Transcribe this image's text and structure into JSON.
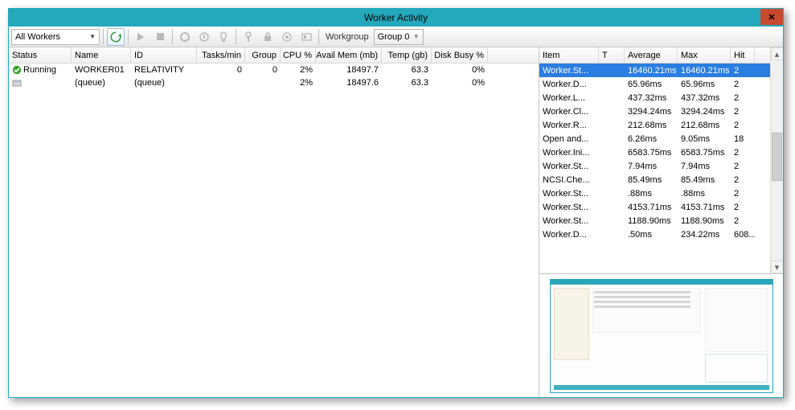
{
  "window": {
    "title": "Worker Activity",
    "close_glyph": "✕"
  },
  "toolbar": {
    "worker_filter": "All Workers",
    "workgroup_label": "Workgroup",
    "group_value": "Group 0"
  },
  "left_grid": {
    "headers": {
      "status": "Status",
      "name": "Name",
      "id": "ID",
      "tasks": "Tasks/min",
      "group": "Group",
      "cpu": "CPU %",
      "mem": "Avail Mem (mb)",
      "temp": "Temp (gb)",
      "disk": "Disk Busy %"
    },
    "rows": [
      {
        "status_icon": "running",
        "status": "Running",
        "name": "WORKER01",
        "id": "RELATIVITY",
        "tasks": "0",
        "group": "0",
        "cpu": "2%",
        "mem": "18497.7",
        "temp": "63.3",
        "disk": "0%"
      },
      {
        "status_icon": "queue",
        "status": "",
        "name": "(queue)",
        "id": "(queue)",
        "tasks": "",
        "group": "",
        "cpu": "2%",
        "mem": "18497.6",
        "temp": "63.3",
        "disk": "0%"
      }
    ]
  },
  "right_grid": {
    "headers": {
      "item": "Item",
      "t": "T",
      "avg": "Average",
      "max": "Max",
      "hit": "Hit"
    },
    "rows": [
      {
        "item": "Worker.St...",
        "t": "",
        "avg": "16460.21ms",
        "max": "16460.21ms",
        "hit": "2",
        "sel": true
      },
      {
        "item": "Worker.D...",
        "t": "",
        "avg": "65.96ms",
        "max": "65.96ms",
        "hit": "2"
      },
      {
        "item": "Worker.L...",
        "t": "",
        "avg": "437.32ms",
        "max": "437.32ms",
        "hit": "2"
      },
      {
        "item": "Worker.Cl...",
        "t": "",
        "avg": "3294.24ms",
        "max": "3294.24ms",
        "hit": "2"
      },
      {
        "item": "Worker.R...",
        "t": "",
        "avg": "212.68ms",
        "max": "212.68ms",
        "hit": "2"
      },
      {
        "item": "Open and...",
        "t": "",
        "avg": "6.26ms",
        "max": "9.05ms",
        "hit": "18"
      },
      {
        "item": "Worker.Ini...",
        "t": "",
        "avg": "6583.75ms",
        "max": "6583.75ms",
        "hit": "2"
      },
      {
        "item": "Worker.St...",
        "t": "",
        "avg": "7.94ms",
        "max": "7.94ms",
        "hit": "2"
      },
      {
        "item": "NCSI.Che...",
        "t": "",
        "avg": "85.49ms",
        "max": "85.49ms",
        "hit": "2"
      },
      {
        "item": "Worker.St...",
        "t": "",
        "avg": ".88ms",
        "max": ".88ms",
        "hit": "2"
      },
      {
        "item": "Worker.St...",
        "t": "",
        "avg": "4153.71ms",
        "max": "4153.71ms",
        "hit": "2"
      },
      {
        "item": "Worker.St...",
        "t": "",
        "avg": "1188.90ms",
        "max": "1188.90ms",
        "hit": "2"
      },
      {
        "item": "Worker.D...",
        "t": "",
        "avg": ".50ms",
        "max": "234.22ms",
        "hit": "608..."
      }
    ]
  }
}
